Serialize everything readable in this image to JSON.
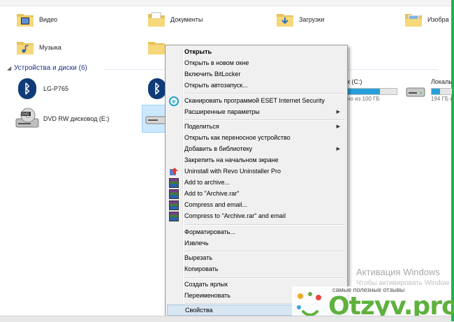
{
  "folders": [
    {
      "label": "Видео",
      "icon": "video-folder-icon"
    },
    {
      "label": "Документы",
      "icon": "documents-folder-icon"
    },
    {
      "label": "Загрузки",
      "icon": "downloads-folder-icon"
    },
    {
      "label": "Изобра",
      "icon": "pictures-folder-icon"
    },
    {
      "label": "Музыка",
      "icon": "music-folder-icon"
    }
  ],
  "devices_section": {
    "title": "Устройства и диски (6)"
  },
  "devices": [
    {
      "label": "LG-P765",
      "icon": "bluetooth-icon"
    },
    {
      "label": "DVD RW дисковод (E:)",
      "icon": "dvd-drive-icon"
    }
  ],
  "drives": [
    {
      "label": "к (C:)",
      "sub": "но из 100 ГБ",
      "fill_percent": 66
    },
    {
      "label": "Локаль",
      "sub": "194 ГБ с"
    }
  ],
  "context_menu": {
    "items": [
      {
        "label": "Открыть",
        "bold": true
      },
      {
        "label": "Открыть в новом окне"
      },
      {
        "label": "Включить BitLocker"
      },
      {
        "label": "Открыть автозапуск..."
      },
      {
        "label": "Сканировать программой ESET Internet Security",
        "icon": "eset-icon"
      },
      {
        "label": "Расширенные параметры",
        "submenu": true
      },
      {
        "label": "Поделиться",
        "submenu": true
      },
      {
        "label": "Открыть как переносное устройство"
      },
      {
        "label": "Добавить в библиотеку",
        "submenu": true
      },
      {
        "label": "Закрепить на начальном экране"
      },
      {
        "label": "Uninstall with Revo Uninstaller Pro",
        "icon": "revo-uninstaller-icon"
      },
      {
        "label": "Add to archive...",
        "icon": "winrar-icon"
      },
      {
        "label": "Add to \"Archive.rar\"",
        "icon": "winrar-icon"
      },
      {
        "label": "Compress and email...",
        "icon": "winrar-icon"
      },
      {
        "label": "Compress to \"Archive.rar\" and email",
        "icon": "winrar-icon"
      },
      {
        "label": "Форматировать..."
      },
      {
        "label": "Извлечь"
      },
      {
        "label": "Вырезать"
      },
      {
        "label": "Копировать"
      },
      {
        "label": "Создать ярлык"
      },
      {
        "label": "Переименовать"
      },
      {
        "label": "Свойства",
        "highlighted": true
      }
    ]
  },
  "watermark": {
    "line1": "Активация Windows",
    "line2": "Чтобы активировать Window"
  },
  "otzyv": {
    "tagline": "самые полезные отзывы",
    "brand": "Otzyv.pro"
  },
  "colors": {
    "accent": "#26a0da",
    "section_title": "#1e3287",
    "brand_green": "#5fb13d",
    "frame_green": "#22b24c"
  }
}
